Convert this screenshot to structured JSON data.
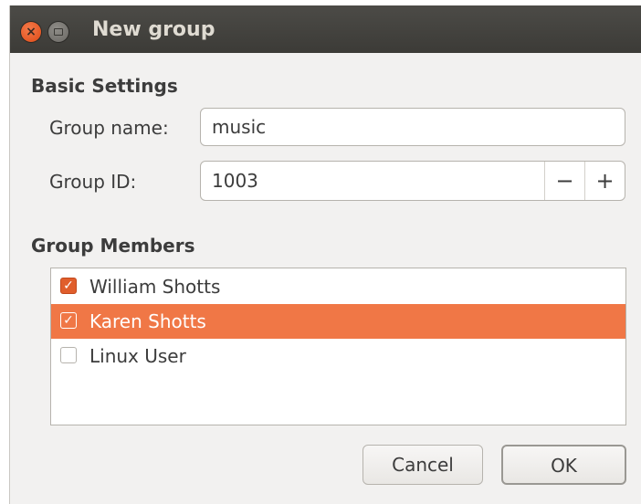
{
  "window": {
    "title": "New group",
    "close_glyph": "×"
  },
  "basic_settings": {
    "heading": "Basic Settings",
    "group_name_label": "Group name:",
    "group_name_value": "music",
    "group_id_label": "Group ID:",
    "group_id_value": "1003",
    "decrement_glyph": "−",
    "increment_glyph": "+"
  },
  "group_members": {
    "heading": "Group Members",
    "members": [
      {
        "name": "William Shotts",
        "checked": true,
        "selected": false
      },
      {
        "name": "Karen Shotts",
        "checked": true,
        "selected": true
      },
      {
        "name": "Linux User",
        "checked": false,
        "selected": false
      }
    ]
  },
  "buttons": {
    "cancel_label": "Cancel",
    "ok_label": "OK"
  },
  "colors": {
    "accent": "#f07746",
    "titlebar": "#3c3b37",
    "close": "#df4a16"
  },
  "icons": {
    "close": "close-icon",
    "minimize": "minimize-icon",
    "check": "check-icon"
  }
}
